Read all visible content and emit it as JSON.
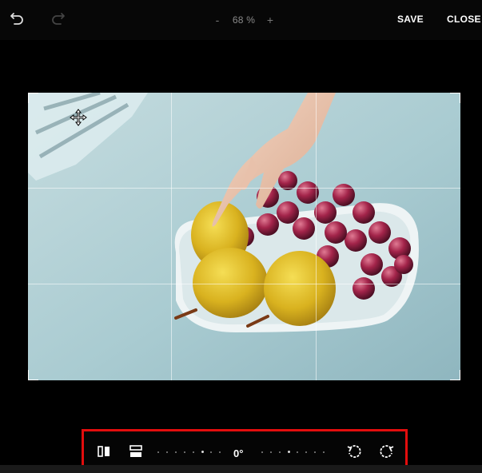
{
  "topbar": {
    "undo_icon": "undo-icon",
    "redo_icon": "redo-icon",
    "zoom": {
      "minus": "-",
      "value": "68 %",
      "plus": "+"
    },
    "save_label": "SAVE",
    "close_label": "CLOSE"
  },
  "image": {
    "subject": "hand reaching for pears and grapes on white plate",
    "crop_handles": [
      "top-left",
      "top-right",
      "bottom-left",
      "bottom-right"
    ],
    "grid": "rule-of-thirds"
  },
  "toolbar": {
    "flip_horizontal_icon": "flip-horizontal-icon",
    "flip_vertical_icon": "flip-vertical-icon",
    "rotation_angle": "0°",
    "rotate_left_icon": "rotate-left-icon",
    "rotate_right_icon": "rotate-right-icon",
    "highlight_color": "#e30d0d"
  }
}
